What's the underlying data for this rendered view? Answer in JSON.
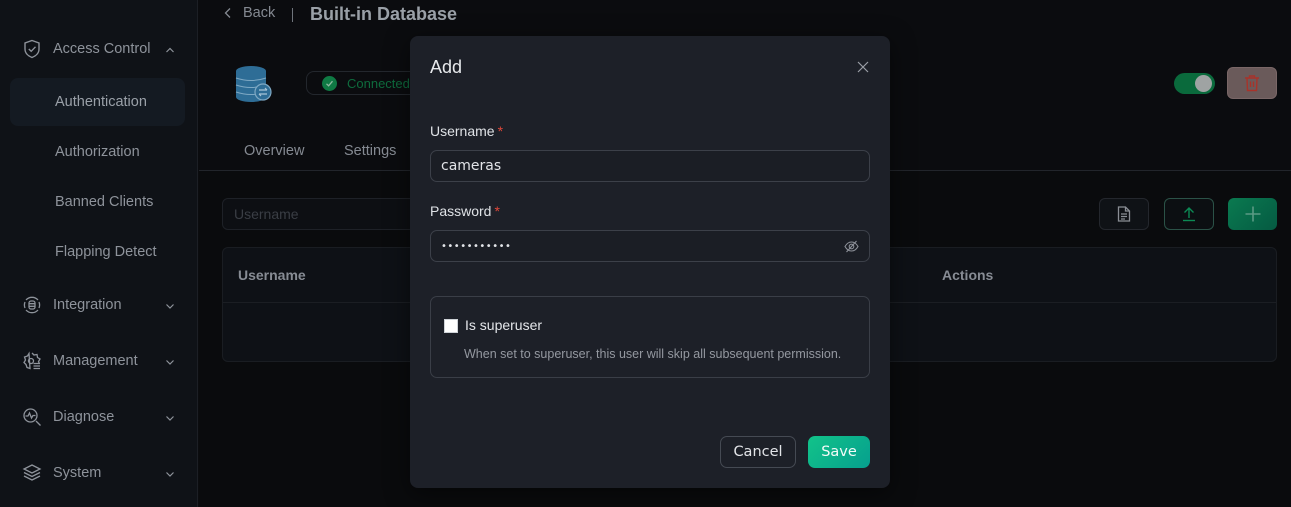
{
  "sidebar": {
    "groups": [
      {
        "label": "Access Control",
        "icon": "shield-check-icon",
        "expanded": true
      },
      {
        "label": "Integration",
        "icon": "integration-icon",
        "expanded": false
      },
      {
        "label": "Management",
        "icon": "management-gear-icon",
        "expanded": false
      },
      {
        "label": "Diagnose",
        "icon": "diagnose-icon",
        "expanded": false
      },
      {
        "label": "System",
        "icon": "layers-icon",
        "expanded": false
      }
    ],
    "access_control_items": [
      {
        "label": "Authentication",
        "active": true
      },
      {
        "label": "Authorization",
        "active": false
      },
      {
        "label": "Banned Clients",
        "active": false
      },
      {
        "label": "Flapping Detect",
        "active": false
      }
    ]
  },
  "header": {
    "back_label": "Back",
    "title": "Built-in Database",
    "status": "Connected",
    "enabled": true
  },
  "tabs": [
    {
      "label": "Overview"
    },
    {
      "label": "Settings"
    }
  ],
  "toolbar": {
    "search_placeholder": "Username"
  },
  "table": {
    "columns": [
      "Username",
      "Actions"
    ],
    "rows": []
  },
  "modal": {
    "title": "Add",
    "username_label": "Username",
    "username_value": "cameras",
    "password_label": "Password",
    "password_value": "•••••••••••",
    "required_mark": "*",
    "superuser_label": "Is superuser",
    "superuser_checked": false,
    "superuser_help": "When set to superuser, this user will skip all subsequent permission.",
    "cancel_label": "Cancel",
    "save_label": "Save"
  },
  "colors": {
    "accent": "#12c389",
    "danger": "#e0483b",
    "connected": "#0f7a44"
  }
}
